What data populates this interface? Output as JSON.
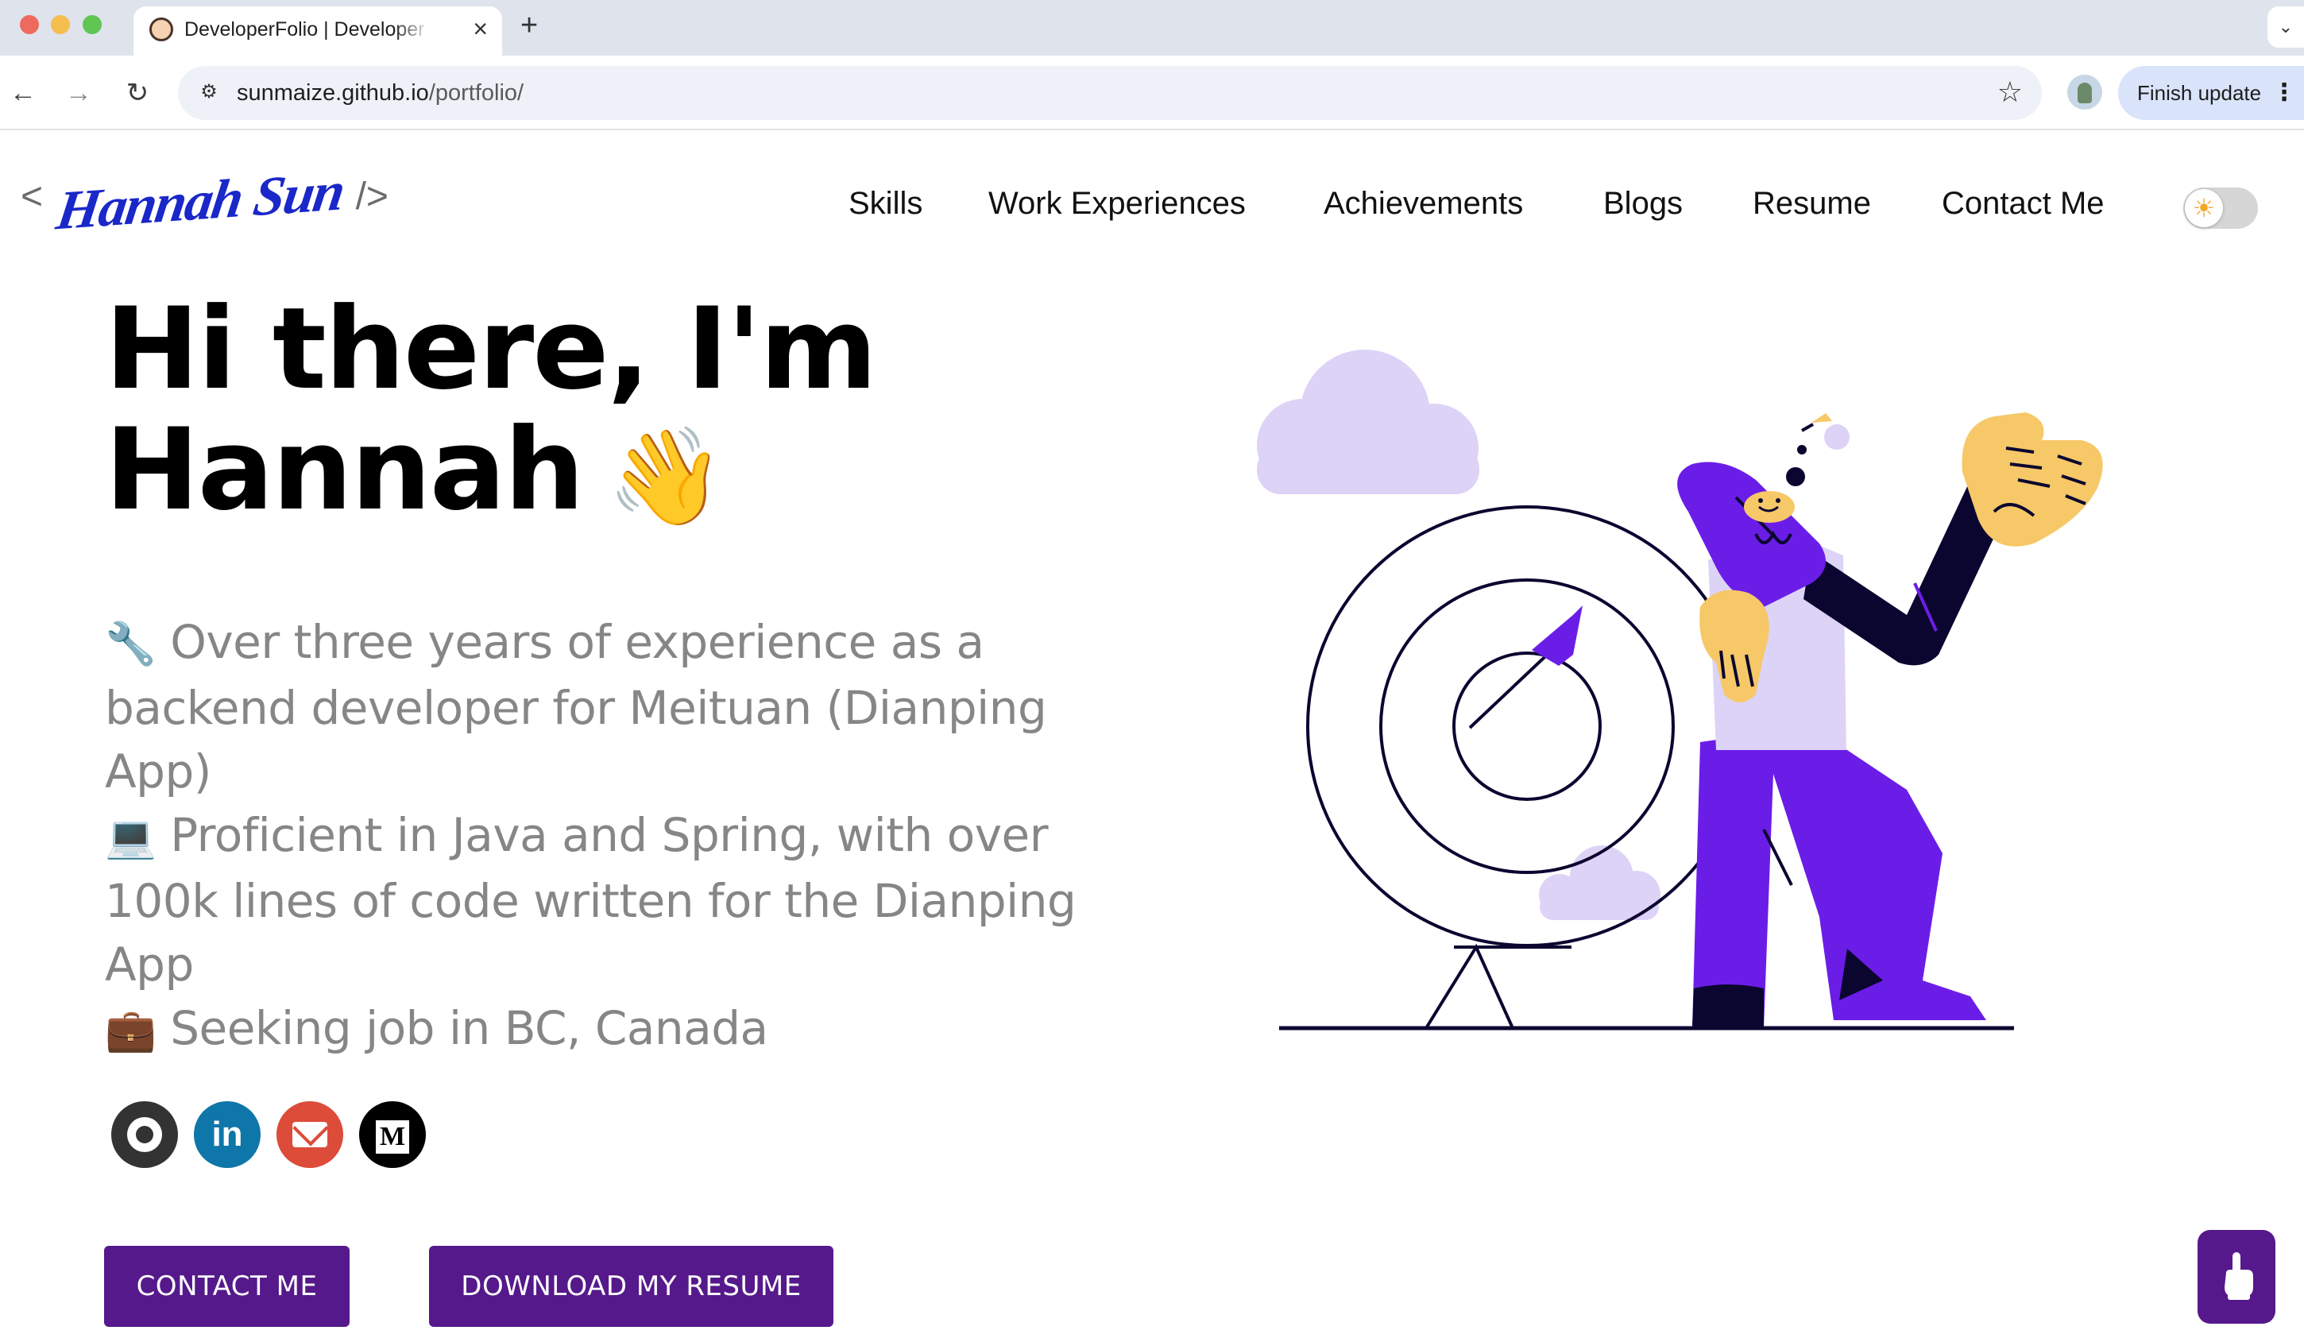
{
  "browser": {
    "tab_title": "DeveloperFolio | Developer Portfolio",
    "tab_close": "×",
    "new_tab": "+",
    "tab_menu": "⌄",
    "url_host": "sunmaize.github.io",
    "url_path": "/portfolio/",
    "finish_update_label": "Finish update",
    "menu_dots": "⋮",
    "back": "←",
    "forward": "→",
    "reload": "↻",
    "star": "☆",
    "site_info": "⚙"
  },
  "logo": {
    "open": "<",
    "name": "Hannah Sun",
    "close": "/>"
  },
  "nav": {
    "items": [
      "Skills",
      "Work Experiences",
      "Achievements",
      "Blogs",
      "Resume",
      "Contact Me"
    ]
  },
  "theme_toggle": {
    "icon": "☀"
  },
  "hero": {
    "greeting_line1": "Hi there, I'm",
    "greeting_line2": "Hannah",
    "wave_emoji": "👋",
    "bio": [
      {
        "emoji": "🔧",
        "text": "Over three years of experience as a backend developer for Meituan (Dianping App)"
      },
      {
        "emoji": "💻",
        "text": "Proficient in Java and Spring, with over 100k lines of code written for the Dianping App"
      },
      {
        "emoji": "💼",
        "text": "Seeking job in BC, Canada"
      }
    ]
  },
  "socials": {
    "linkedin_glyph": "in",
    "medium_glyph": "M"
  },
  "buttons": {
    "contact": "CONTACT ME",
    "resume": "DOWNLOAD MY RESUME"
  },
  "colors": {
    "primary": "#55198b",
    "illustration_purple": "#6b1de8",
    "illustration_lavender": "#ddd3f7",
    "illustration_yellow": "#f6c867",
    "illustration_navy": "#0b0630"
  }
}
